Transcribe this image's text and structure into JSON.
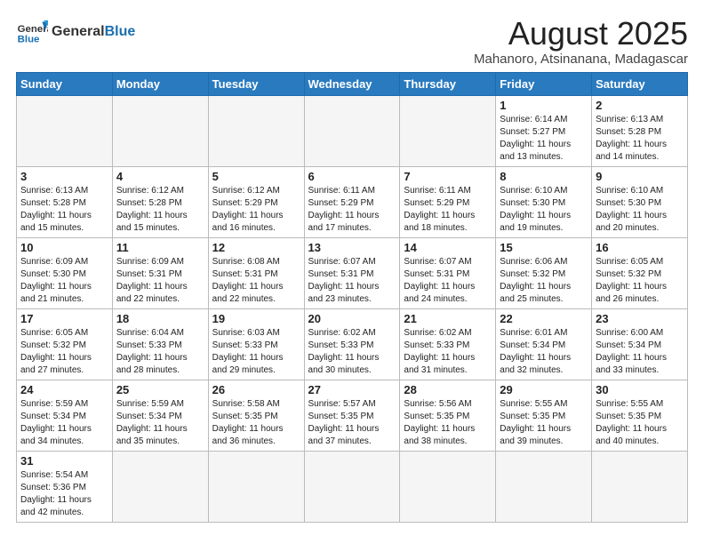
{
  "header": {
    "logo_general": "General",
    "logo_blue": "Blue",
    "month_title": "August 2025",
    "location": "Mahanoro, Atsinanana, Madagascar"
  },
  "days_of_week": [
    "Sunday",
    "Monday",
    "Tuesday",
    "Wednesday",
    "Thursday",
    "Friday",
    "Saturday"
  ],
  "weeks": [
    [
      {
        "day": "",
        "info": ""
      },
      {
        "day": "",
        "info": ""
      },
      {
        "day": "",
        "info": ""
      },
      {
        "day": "",
        "info": ""
      },
      {
        "day": "",
        "info": ""
      },
      {
        "day": "1",
        "info": "Sunrise: 6:14 AM\nSunset: 5:27 PM\nDaylight: 11 hours and 13 minutes."
      },
      {
        "day": "2",
        "info": "Sunrise: 6:13 AM\nSunset: 5:28 PM\nDaylight: 11 hours and 14 minutes."
      }
    ],
    [
      {
        "day": "3",
        "info": "Sunrise: 6:13 AM\nSunset: 5:28 PM\nDaylight: 11 hours and 15 minutes."
      },
      {
        "day": "4",
        "info": "Sunrise: 6:12 AM\nSunset: 5:28 PM\nDaylight: 11 hours and 15 minutes."
      },
      {
        "day": "5",
        "info": "Sunrise: 6:12 AM\nSunset: 5:29 PM\nDaylight: 11 hours and 16 minutes."
      },
      {
        "day": "6",
        "info": "Sunrise: 6:11 AM\nSunset: 5:29 PM\nDaylight: 11 hours and 17 minutes."
      },
      {
        "day": "7",
        "info": "Sunrise: 6:11 AM\nSunset: 5:29 PM\nDaylight: 11 hours and 18 minutes."
      },
      {
        "day": "8",
        "info": "Sunrise: 6:10 AM\nSunset: 5:30 PM\nDaylight: 11 hours and 19 minutes."
      },
      {
        "day": "9",
        "info": "Sunrise: 6:10 AM\nSunset: 5:30 PM\nDaylight: 11 hours and 20 minutes."
      }
    ],
    [
      {
        "day": "10",
        "info": "Sunrise: 6:09 AM\nSunset: 5:30 PM\nDaylight: 11 hours and 21 minutes."
      },
      {
        "day": "11",
        "info": "Sunrise: 6:09 AM\nSunset: 5:31 PM\nDaylight: 11 hours and 22 minutes."
      },
      {
        "day": "12",
        "info": "Sunrise: 6:08 AM\nSunset: 5:31 PM\nDaylight: 11 hours and 22 minutes."
      },
      {
        "day": "13",
        "info": "Sunrise: 6:07 AM\nSunset: 5:31 PM\nDaylight: 11 hours and 23 minutes."
      },
      {
        "day": "14",
        "info": "Sunrise: 6:07 AM\nSunset: 5:31 PM\nDaylight: 11 hours and 24 minutes."
      },
      {
        "day": "15",
        "info": "Sunrise: 6:06 AM\nSunset: 5:32 PM\nDaylight: 11 hours and 25 minutes."
      },
      {
        "day": "16",
        "info": "Sunrise: 6:05 AM\nSunset: 5:32 PM\nDaylight: 11 hours and 26 minutes."
      }
    ],
    [
      {
        "day": "17",
        "info": "Sunrise: 6:05 AM\nSunset: 5:32 PM\nDaylight: 11 hours and 27 minutes."
      },
      {
        "day": "18",
        "info": "Sunrise: 6:04 AM\nSunset: 5:33 PM\nDaylight: 11 hours and 28 minutes."
      },
      {
        "day": "19",
        "info": "Sunrise: 6:03 AM\nSunset: 5:33 PM\nDaylight: 11 hours and 29 minutes."
      },
      {
        "day": "20",
        "info": "Sunrise: 6:02 AM\nSunset: 5:33 PM\nDaylight: 11 hours and 30 minutes."
      },
      {
        "day": "21",
        "info": "Sunrise: 6:02 AM\nSunset: 5:33 PM\nDaylight: 11 hours and 31 minutes."
      },
      {
        "day": "22",
        "info": "Sunrise: 6:01 AM\nSunset: 5:34 PM\nDaylight: 11 hours and 32 minutes."
      },
      {
        "day": "23",
        "info": "Sunrise: 6:00 AM\nSunset: 5:34 PM\nDaylight: 11 hours and 33 minutes."
      }
    ],
    [
      {
        "day": "24",
        "info": "Sunrise: 5:59 AM\nSunset: 5:34 PM\nDaylight: 11 hours and 34 minutes."
      },
      {
        "day": "25",
        "info": "Sunrise: 5:59 AM\nSunset: 5:34 PM\nDaylight: 11 hours and 35 minutes."
      },
      {
        "day": "26",
        "info": "Sunrise: 5:58 AM\nSunset: 5:35 PM\nDaylight: 11 hours and 36 minutes."
      },
      {
        "day": "27",
        "info": "Sunrise: 5:57 AM\nSunset: 5:35 PM\nDaylight: 11 hours and 37 minutes."
      },
      {
        "day": "28",
        "info": "Sunrise: 5:56 AM\nSunset: 5:35 PM\nDaylight: 11 hours and 38 minutes."
      },
      {
        "day": "29",
        "info": "Sunrise: 5:55 AM\nSunset: 5:35 PM\nDaylight: 11 hours and 39 minutes."
      },
      {
        "day": "30",
        "info": "Sunrise: 5:55 AM\nSunset: 5:35 PM\nDaylight: 11 hours and 40 minutes."
      }
    ],
    [
      {
        "day": "31",
        "info": "Sunrise: 5:54 AM\nSunset: 5:36 PM\nDaylight: 11 hours and 42 minutes."
      },
      {
        "day": "",
        "info": ""
      },
      {
        "day": "",
        "info": ""
      },
      {
        "day": "",
        "info": ""
      },
      {
        "day": "",
        "info": ""
      },
      {
        "day": "",
        "info": ""
      },
      {
        "day": "",
        "info": ""
      }
    ]
  ]
}
